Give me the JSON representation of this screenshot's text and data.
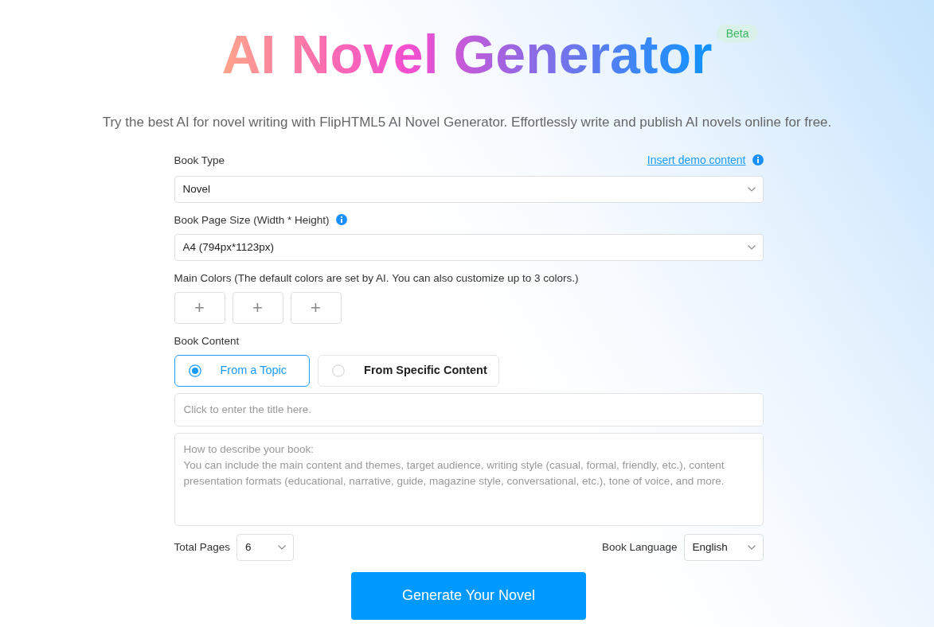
{
  "header": {
    "title": "AI Novel Generator",
    "badge": "Beta",
    "subtitle": "Try the best AI for novel writing with FlipHTML5 AI Novel Generator. Effortlessly write and publish AI novels online for free."
  },
  "demo_link": {
    "text": "Insert demo content",
    "info": true
  },
  "fields": [
    {
      "kind": "select",
      "label": "Book Type",
      "value": "Novel"
    },
    {
      "kind": "select",
      "label": "Book Page Size (Width * Height)",
      "value": "A4 (794px*1123px)",
      "info": true
    },
    {
      "kind": "swatches",
      "label": "Main Colors (The default colors are set by AI. You can also customize up to 3 colors.)",
      "slots": [
        "+",
        "+",
        "+"
      ]
    },
    {
      "kind": "choice",
      "label": "Book Content",
      "options": [
        {
          "label": "From a Topic",
          "selected": true
        },
        {
          "label": "From Specific Content",
          "selected": false
        }
      ]
    },
    {
      "kind": "text",
      "placeholder": "Click to enter the title here."
    },
    {
      "kind": "textarea",
      "placeholder": "How to describe your book:\nYou can include the main content and themes, target audience, writing style (casual, formal, friendly, etc.), content presentation formats (educational, narrative, guide, magazine style, conversational, etc.), tone of voice, and more."
    }
  ],
  "settings": [
    {
      "label": "Total Pages",
      "value": "6"
    },
    {
      "label": "Book Language",
      "value": "English"
    }
  ],
  "submit": {
    "label": "Generate Your Novel"
  }
}
